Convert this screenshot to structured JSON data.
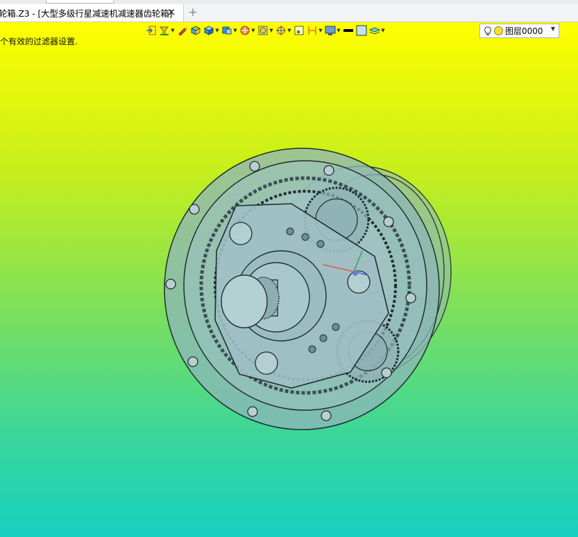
{
  "window": {
    "tab_title": "轮箱.Z3 - [大型多级行星减速机减速器齿轮箱]",
    "tab_close": "✕",
    "tab_add": "+"
  },
  "viewport": {
    "filter_message": "个有效的过滤器设置.",
    "background_top": "#ffff00",
    "background_bottom": "#16d0bf"
  },
  "toolbar": {
    "buttons": [
      {
        "icon": "exit-icon"
      },
      {
        "icon": "filter-icon"
      },
      {
        "icon": "pencil-icon"
      },
      {
        "icon": "solid-box-icon"
      },
      {
        "icon": "shaded-box-icon"
      },
      {
        "icon": "view-box-icon"
      },
      {
        "icon": "section-icon"
      },
      {
        "icon": "render-mode-icon"
      },
      {
        "icon": "crosshair-icon"
      },
      {
        "icon": "frame-icon"
      },
      {
        "icon": "dimension-icon"
      },
      {
        "icon": "display-icon"
      },
      {
        "icon": "line-color-icon"
      },
      {
        "icon": "fill-color-icon"
      },
      {
        "icon": "layers-icon"
      }
    ],
    "layer": {
      "name": "图层0000",
      "bulb_icon": "lightbulb-icon",
      "color": "#f3e23a"
    }
  }
}
